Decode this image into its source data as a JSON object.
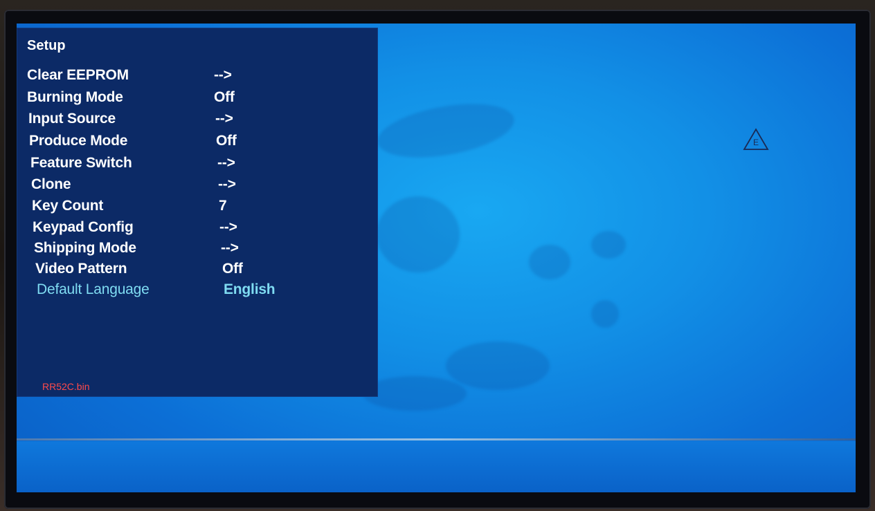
{
  "osd": {
    "title": "Setup",
    "items": [
      {
        "label": "Clear EEPROM",
        "value": "-->"
      },
      {
        "label": "Burning Mode",
        "value": "Off"
      },
      {
        "label": "Input Source",
        "value": "-->"
      },
      {
        "label": "Produce Mode",
        "value": "Off"
      },
      {
        "label": "Feature Switch",
        "value": "-->"
      },
      {
        "label": "Clone",
        "value": "-->"
      },
      {
        "label": "Key Count",
        "value": "7"
      },
      {
        "label": "Keypad Config",
        "value": "-->"
      },
      {
        "label": "Shipping Mode",
        "value": "-->"
      },
      {
        "label": "Video Pattern",
        "value": "Off"
      },
      {
        "label": "Default Language",
        "value": "English",
        "selected": true
      }
    ],
    "firmware": "RR52C.bin"
  },
  "colors": {
    "menu_bg": "#0c2a66",
    "screen_blue": "#1290e6",
    "selected_text": "#7fdcf2",
    "firmware_text": "#ff4a4a"
  },
  "icons": {
    "warning": "warning-triangle-icon"
  }
}
